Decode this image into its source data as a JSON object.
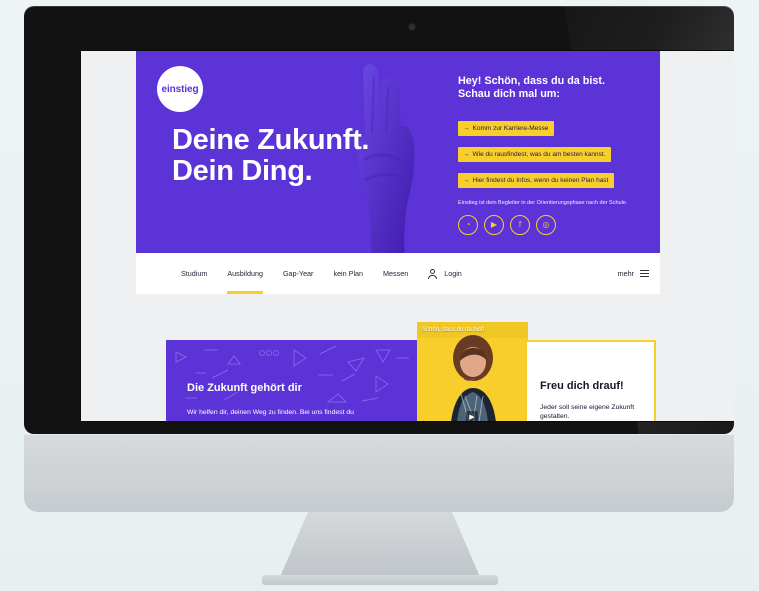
{
  "hero": {
    "logo": "einstieg",
    "title_line1": "Deine Zukunft.",
    "title_line2": "Dein Ding.",
    "greeting": "Hey! Schön, dass du da bist.\nSchau dich mal um:",
    "buttons": [
      {
        "label": "Komm zur Karriere-Messe"
      },
      {
        "label": "Wie du rausfindest, was du am besten kannst."
      },
      {
        "label": "Hier findest du Infos, wenn du keinen Plan hast"
      }
    ],
    "description": "Einstieg ist dein Begleiter in der Orientierungsphase nach der Schule.",
    "social": [
      {
        "glyph": "◔"
      },
      {
        "glyph": "▶"
      },
      {
        "glyph": "f"
      },
      {
        "glyph": "◎"
      }
    ]
  },
  "nav": {
    "items": [
      {
        "label": "Studium"
      },
      {
        "label": "Ausbildung"
      },
      {
        "label": "Gap-Year"
      },
      {
        "label": "kein Plan"
      },
      {
        "label": "Messen"
      },
      {
        "label": "Login"
      }
    ],
    "more": "mehr"
  },
  "cards": {
    "purple": {
      "title": "Die Zukunft gehört dir",
      "text": "Wir helfen dir, deinen Weg zu finden. Bei uns findest du"
    },
    "video": {
      "label": "Schön, dass du da bist!",
      "play_glyph": "▶"
    },
    "outline": {
      "title": "Freu dich drauf!",
      "text": "Jeder soll seine eigene Zukunft gestalten."
    }
  },
  "colors": {
    "brand_purple": "#5b33d7",
    "accent_yellow": "#f8ce2a",
    "frame_black": "#121212",
    "stand_silver": "#c6cbcf"
  },
  "icons": {
    "menu": "menu-icon",
    "login": "person-icon",
    "play": "play-icon",
    "snapchat": "snapchat-icon",
    "youtube": "youtube-icon",
    "facebook": "facebook-icon",
    "instagram": "instagram-icon"
  }
}
